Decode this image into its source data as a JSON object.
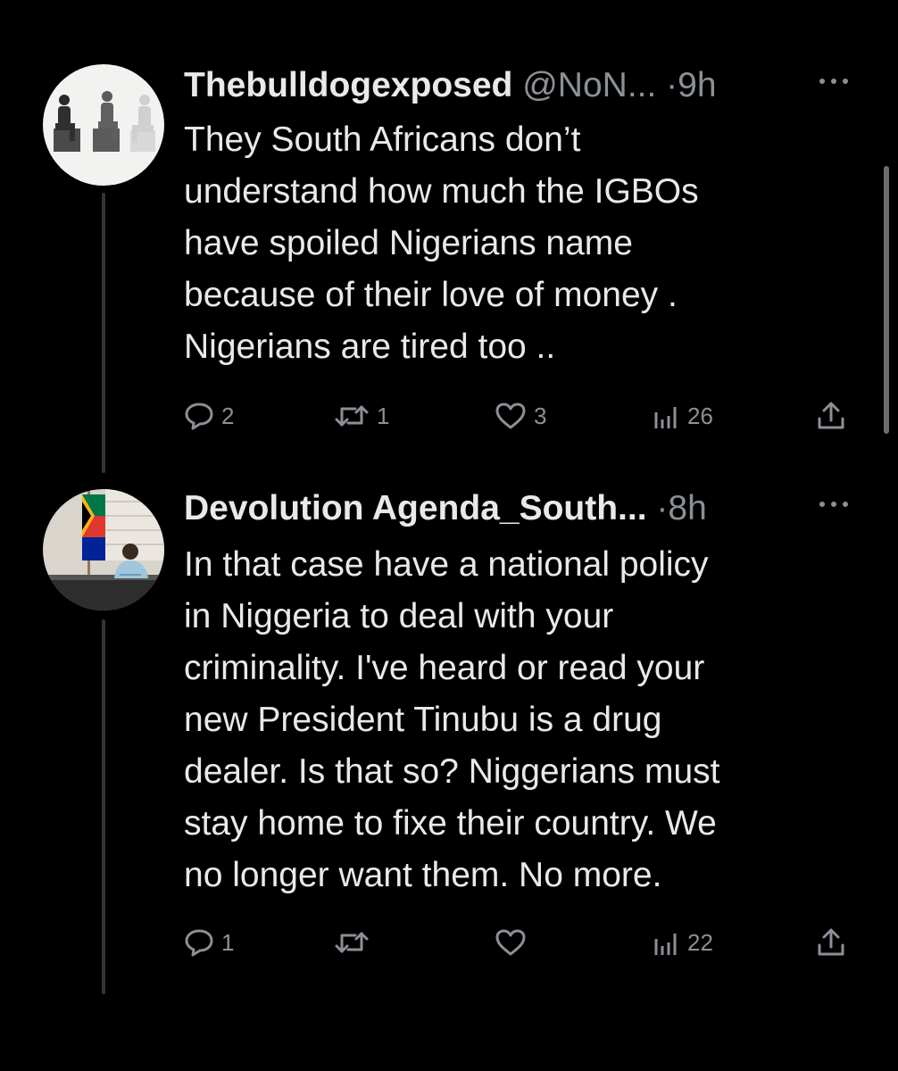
{
  "tweets": [
    {
      "name": "Thebulldogexposed",
      "handle": "@NoN...",
      "separator": "·",
      "time": "9h",
      "text": "They South Africans don’t\nunderstand how much the IGBOs\nhave spoiled Nigerians name\nbecause of their love of money .\nNigerians are tired too ..",
      "replies": "2",
      "reposts": "1",
      "likes": "3",
      "views": "26",
      "avatar_icon": "mannequins-avatar-icon"
    },
    {
      "name": "Devolution Agenda_South...",
      "separator": "·",
      "time": "8h",
      "text": "In that case have a national policy\nin Niggeria to deal with your\ncriminality. I've heard or read your\nnew President Tinubu is a drug\ndealer. Is that so? Niggerians must\nstay home to fixe their country. We\nno longer want them. No more.",
      "replies": "1",
      "reposts": "",
      "likes": "",
      "views": "22",
      "avatar_icon": "flag-office-avatar-icon"
    }
  ],
  "colors": {
    "background": "#000000",
    "text_primary": "#e7e9ea",
    "text_secondary": "#8b9096",
    "thread_line": "#333639"
  },
  "icons": {
    "reply": "reply-icon",
    "repost": "repost-icon",
    "like": "heart-icon",
    "views": "views-icon",
    "share": "share-icon",
    "more": "more-icon"
  }
}
